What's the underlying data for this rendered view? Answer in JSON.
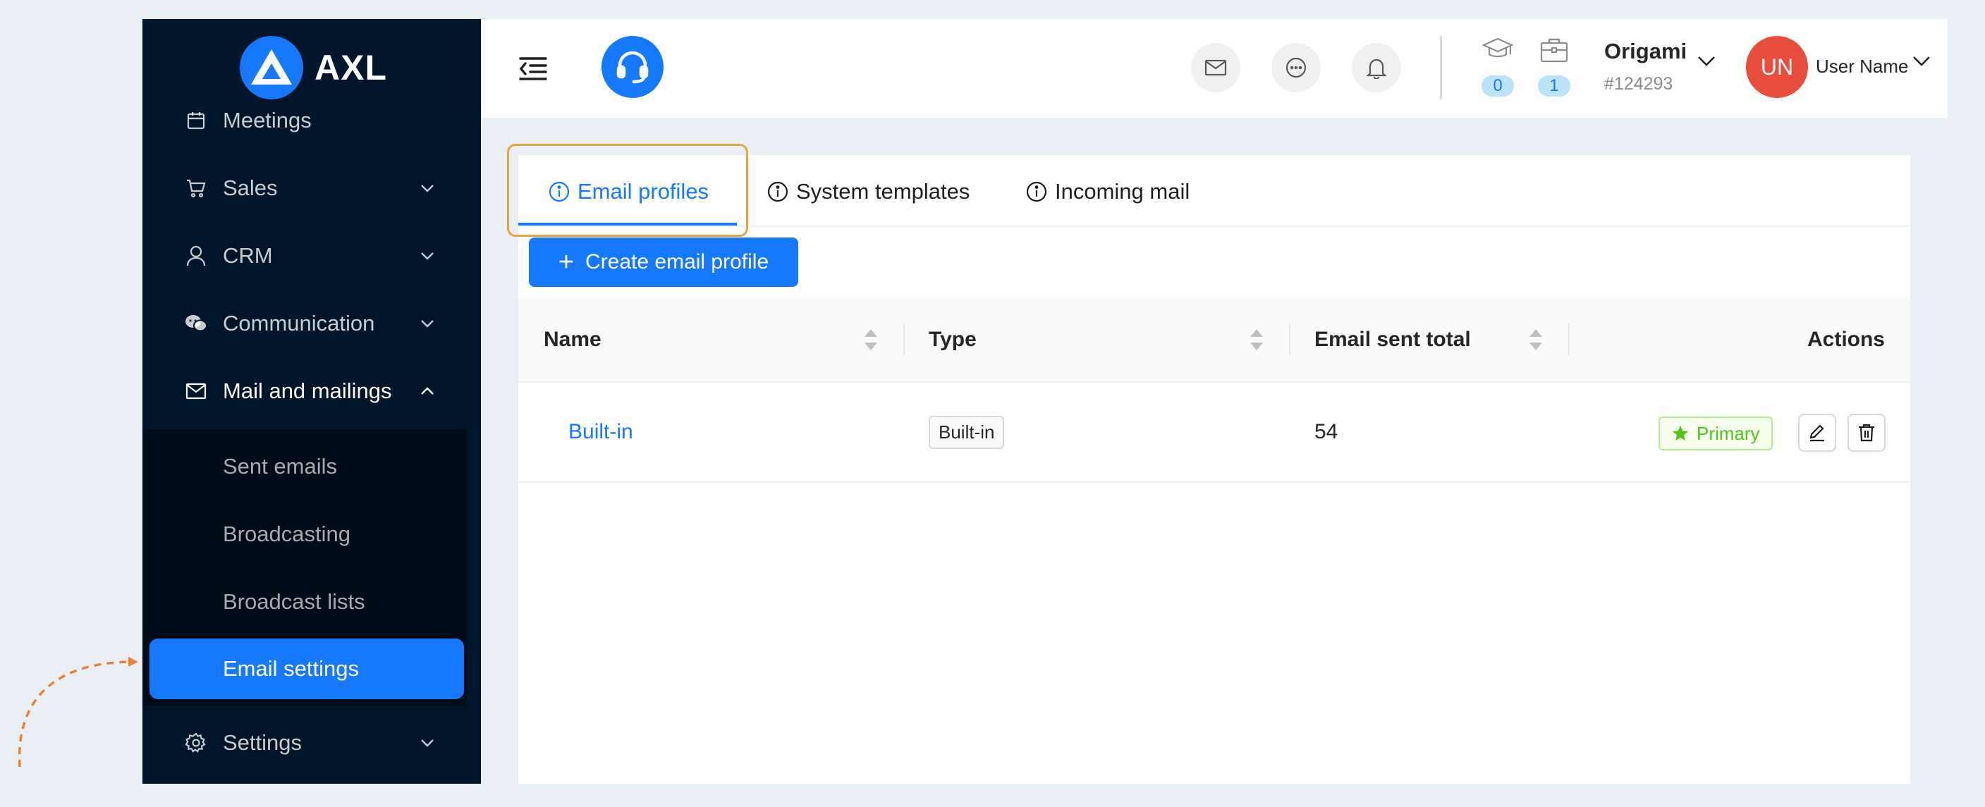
{
  "brand": {
    "name": "AXL"
  },
  "sidebar": {
    "items": [
      {
        "label": "Meetings",
        "icon": "calendar-icon"
      },
      {
        "label": "Sales",
        "icon": "cart-icon"
      },
      {
        "label": "CRM",
        "icon": "user-icon"
      },
      {
        "label": "Communication",
        "icon": "chat-icon"
      },
      {
        "label": "Mail and mailings",
        "icon": "mail-icon"
      },
      {
        "label": "Settings",
        "icon": "gear-icon"
      }
    ],
    "submenu": [
      {
        "label": "Sent emails"
      },
      {
        "label": "Broadcasting"
      },
      {
        "label": "Broadcast lists"
      },
      {
        "label": "Email settings",
        "active": true
      }
    ]
  },
  "header": {
    "badges": [
      {
        "icon": "graduation-cap-icon",
        "count": "0"
      },
      {
        "icon": "briefcase-icon",
        "count": "1"
      }
    ],
    "org": {
      "name": "Origami",
      "id": "#124293"
    },
    "user": {
      "initials": "UN",
      "name": "User Name"
    }
  },
  "tabs": [
    {
      "label": "Email profiles",
      "active": true
    },
    {
      "label": "System templates"
    },
    {
      "label": "Incoming mail"
    }
  ],
  "toolbar": {
    "create_label": "Create email profile"
  },
  "table": {
    "columns": [
      "Name",
      "Type",
      "Email sent total",
      "Actions"
    ],
    "rows": [
      {
        "name": "Built-in",
        "type": "Built-in",
        "sent_total": "54",
        "status": "Primary"
      }
    ]
  },
  "colors": {
    "accent": "#1677ff",
    "sidebar": "#001529",
    "highlight": "#e0a73d",
    "success": "#52c41a",
    "avatar": "#e74c3c"
  }
}
